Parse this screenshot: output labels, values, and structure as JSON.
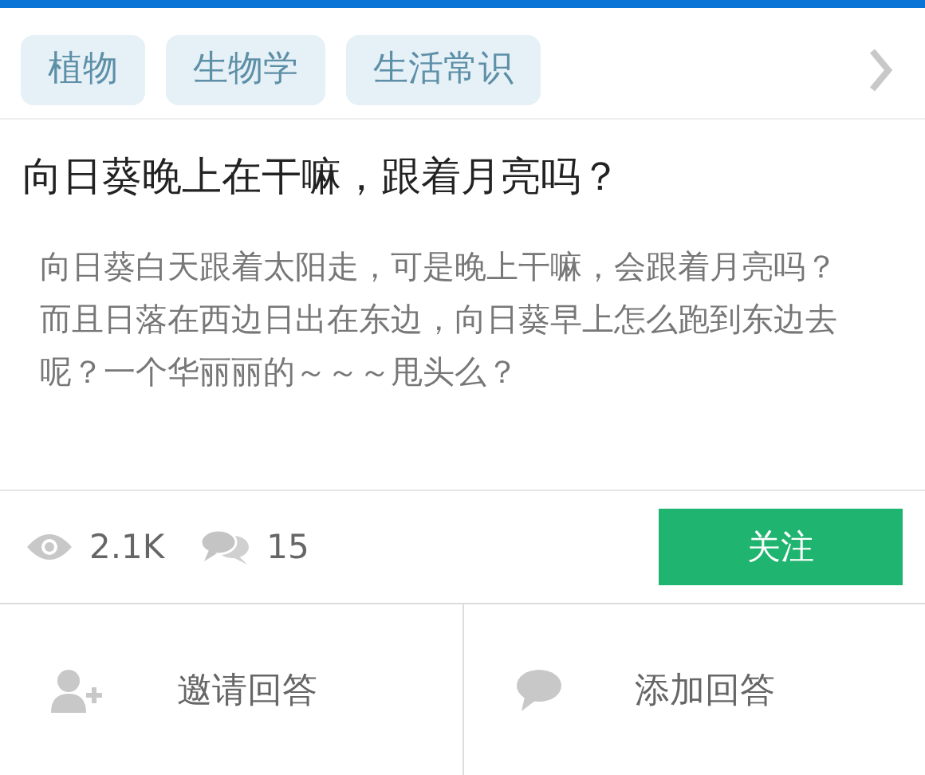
{
  "tags": [
    {
      "label": "植物"
    },
    {
      "label": "生物学"
    },
    {
      "label": "生活常识"
    }
  ],
  "question": {
    "title": "向日葵晚上在干嘛，跟着月亮吗？",
    "body": [
      "向日葵白天跟着太阳走，可是晚上干嘛，会跟着月亮吗？",
      "而且日落在西边日出在东边，向日葵早上怎么跑到东边去呢？一个华丽丽的～～～甩头么？"
    ]
  },
  "stats": {
    "views": "2.1K",
    "comments": "15"
  },
  "follow_button": "关注",
  "actions": [
    {
      "kind": "invite",
      "label": "邀请回答"
    },
    {
      "kind": "answer",
      "label": "添加回答"
    }
  ]
}
